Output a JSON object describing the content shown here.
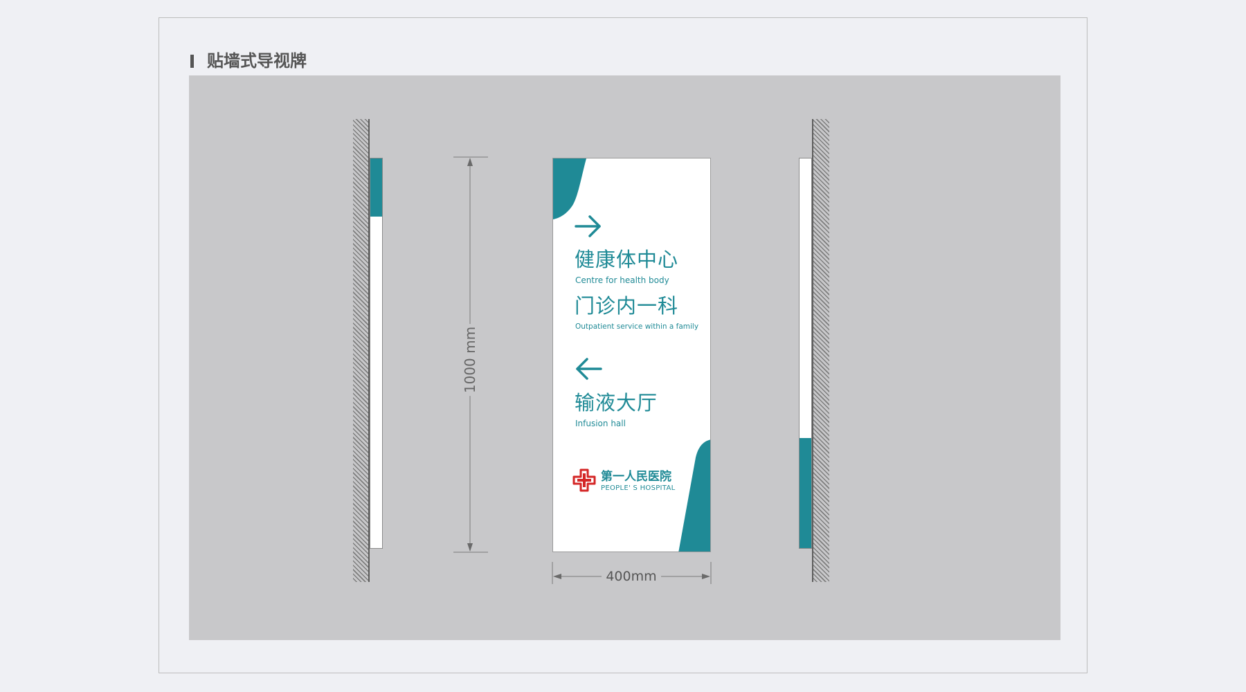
{
  "header": {
    "title": "贴墙式导视牌"
  },
  "sign": {
    "directions": [
      {
        "arrow": "arrow-right-icon",
        "cn": "健康体中心",
        "en": "Centre for health body"
      },
      {
        "arrow": "",
        "cn": "门诊内一科",
        "en": "Outpatient service within a family"
      },
      {
        "arrow": "arrow-left-icon",
        "cn": "输液大厅",
        "en": "Infusion hall"
      }
    ],
    "logo": {
      "icon": "red-cross-icon",
      "cn": "第一人民医院",
      "en": "PEOPLE' S HOSPITAL"
    }
  },
  "dimensions": {
    "height": "1000 mm",
    "width": "400mm"
  },
  "colors": {
    "accent": "#1f8a96",
    "logo_red": "#d42626",
    "panel": "#c8c8ca",
    "background": "#eff0f4"
  }
}
